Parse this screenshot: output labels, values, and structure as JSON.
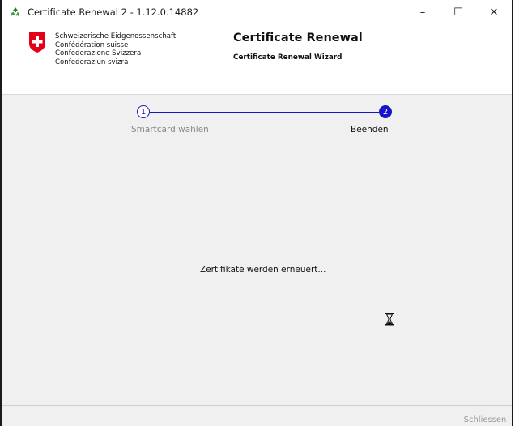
{
  "window": {
    "title": "Certificate Renewal 2 - 1.12.0.14882",
    "minimize": "–",
    "maximize": "☐",
    "close": "✕"
  },
  "header": {
    "gov_lines": [
      "Schweizerische Eidgenossenschaft",
      "Confédération suisse",
      "Confederazione Svizzera",
      "Confederaziun svizra"
    ],
    "title": "Certificate Renewal",
    "subtitle": "Certificate Renewal Wizard"
  },
  "stepper": {
    "steps": [
      {
        "number": "1",
        "label": "Smartcard wählen"
      },
      {
        "number": "2",
        "label": "Beenden"
      }
    ]
  },
  "content": {
    "status": "Zertifikate werden erneuert..."
  },
  "footer": {
    "close_label": "Schliessen"
  },
  "colors": {
    "accent": "#1414c8",
    "flag_red": "#e3001b"
  },
  "icons": [
    "recycle-icon",
    "swiss-flag-icon",
    "hourglass-icon"
  ]
}
